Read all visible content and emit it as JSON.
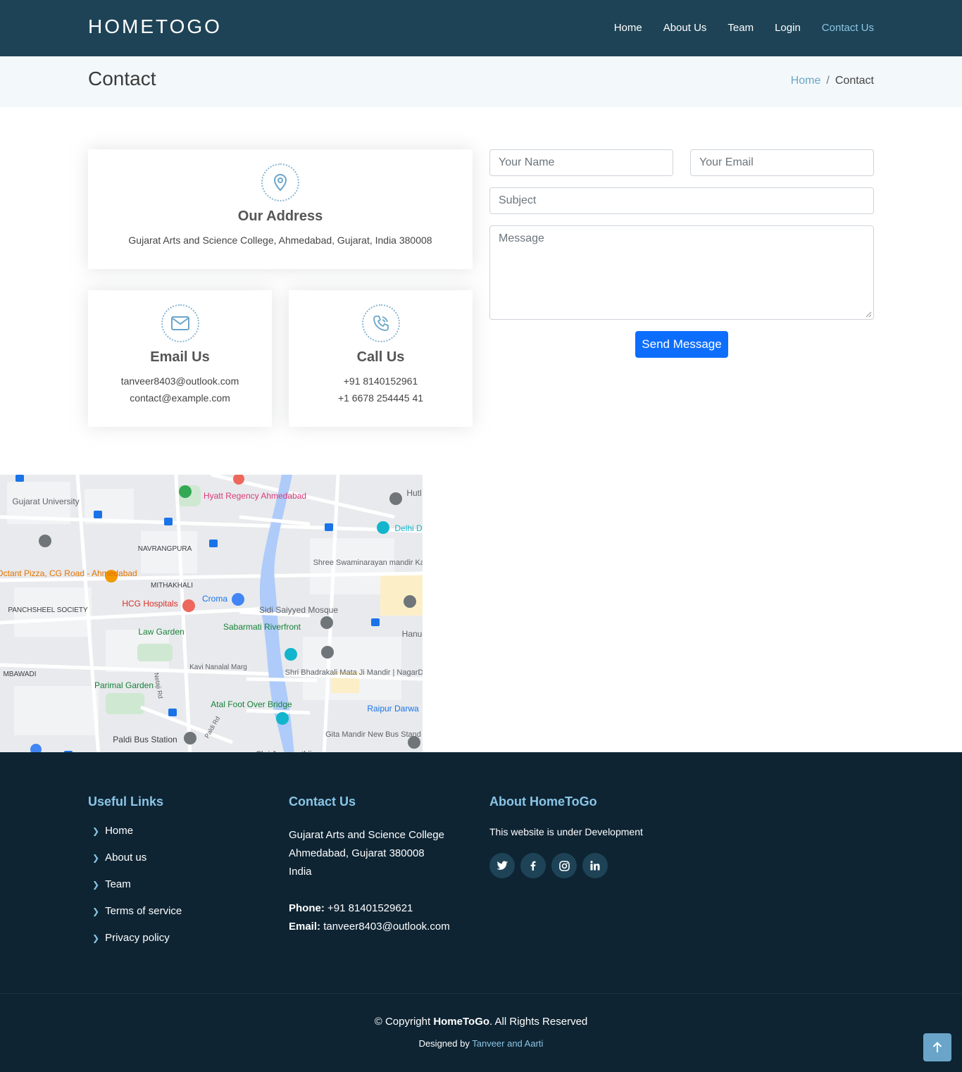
{
  "header": {
    "logo": "HOMETOGO",
    "nav": [
      "Home",
      "About Us",
      "Team",
      "Login",
      "Contact Us"
    ]
  },
  "breadcrumbs": {
    "title": "Contact",
    "home": "Home",
    "separator": "/",
    "current": "Contact"
  },
  "info": {
    "address": {
      "title": "Our Address",
      "text": "Gujarat Arts and Science College, Ahmedabad, Gujarat, India 380008"
    },
    "email": {
      "title": "Email Us",
      "lines": [
        "tanveer8403@outlook.com",
        "contact@example.com"
      ]
    },
    "call": {
      "title": "Call Us",
      "lines": [
        "+91 8140152961",
        "+1 6678 254445 41"
      ]
    }
  },
  "form": {
    "name_placeholder": "Your Name",
    "email_placeholder": "Your Email",
    "subject_placeholder": "Subject",
    "message_placeholder": "Message",
    "submit": "Send Message"
  },
  "map": {
    "labels": [
      "Gujarat University",
      "Hyatt Regency Ahmedabad",
      "NAVRANGPURA",
      "Octant Pizza, CG Road - Ahmedabad",
      "MITHAKHALI",
      "HCG Hospitals",
      "Croma",
      "PANCHSHEEL SOCIETY",
      "Sidi Saiyyed Mosque",
      "Sabarmati Riverfront",
      "Law Garden",
      "Shree Swaminarayan mandir Kalupur",
      "Delhi D",
      "Kavi Nanalal Marg",
      "Shri Bhadrakali Mata Ji Mandir | NagarDevi",
      "Parimal Garden",
      "Atal Foot Over Bridge",
      "Raipur Darwa",
      "Paldi Bus Station",
      "Gita Mandir New Bus Stand",
      "Shri Jagannathji",
      "Hanu",
      "Hutl",
      "MBAWADI",
      "Netaji Rd",
      "Paldi Rd"
    ]
  },
  "footer": {
    "useful_links_title": "Useful Links",
    "useful_links": [
      "Home",
      "About us",
      "Team",
      "Terms of service",
      "Privacy policy"
    ],
    "contact_title": "Contact Us",
    "contact_lines": [
      "Gujarat Arts and Science College",
      "Ahmedabad, Gujarat 380008",
      "India"
    ],
    "phone_label": "Phone:",
    "phone_value": "+91 81401529621",
    "email_label": "Email:",
    "email_value": "tanveer8403@outlook.com",
    "about_title": "About HomeToGo",
    "about_text": "This website is under Development",
    "socials": [
      "twitter-icon",
      "facebook-icon",
      "instagram-icon",
      "linkedin-icon"
    ],
    "copyright_prefix": "© Copyright",
    "copyright_brand": "HomeToGo",
    "copyright_suffix": ". All Rights Reserved",
    "designed_by": "Designed by",
    "designers": "Tanveer and Aarti"
  }
}
